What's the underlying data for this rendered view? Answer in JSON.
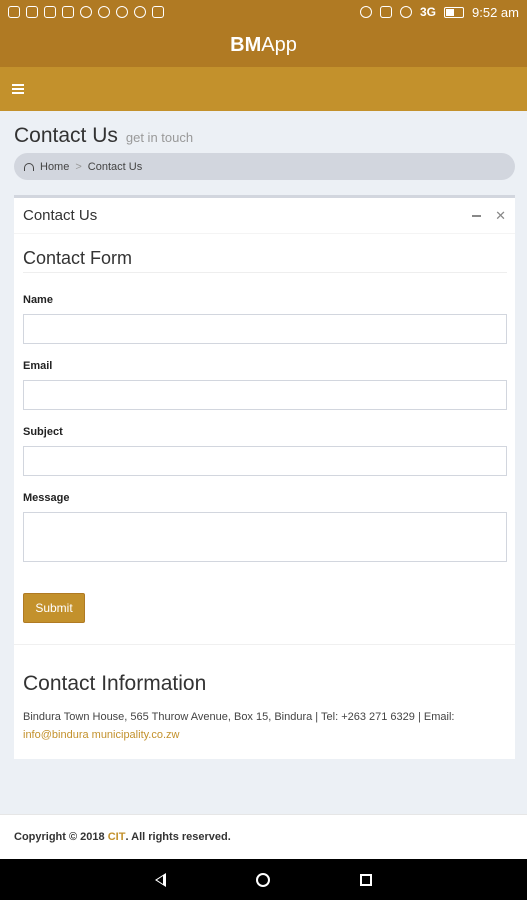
{
  "status_bar": {
    "network": "3G",
    "time": "9:52 am"
  },
  "app": {
    "title_bold": "BM",
    "title_rest": "App"
  },
  "page": {
    "title": "Contact Us",
    "subtitle": "get in touch"
  },
  "breadcrumb": {
    "home": "Home",
    "separator": ">",
    "current": "Contact Us"
  },
  "box": {
    "title": "Contact Us",
    "minimize_icon": "minus-icon",
    "close_icon": "close-icon"
  },
  "form": {
    "title": "Contact Form",
    "name_label": "Name",
    "email_label": "Email",
    "subject_label": "Subject",
    "message_label": "Message",
    "name_value": "",
    "email_value": "",
    "subject_value": "",
    "message_value": "",
    "submit_label": "Submit"
  },
  "contact_info": {
    "title": "Contact Information",
    "address_text": "Bindura Town House, 565 Thurow Avenue, Box 15, Bindura | Tel: +263 271 6329 | Email:",
    "email": "info@bindura municipality.co.zw"
  },
  "footer": {
    "copyright_prefix": "Copyright © 2018",
    "brand": "CIT",
    "rights": ". All rights reserved."
  },
  "colors": {
    "header": "#b07a23",
    "nav": "#c3912c",
    "accent": "#c3912c"
  }
}
